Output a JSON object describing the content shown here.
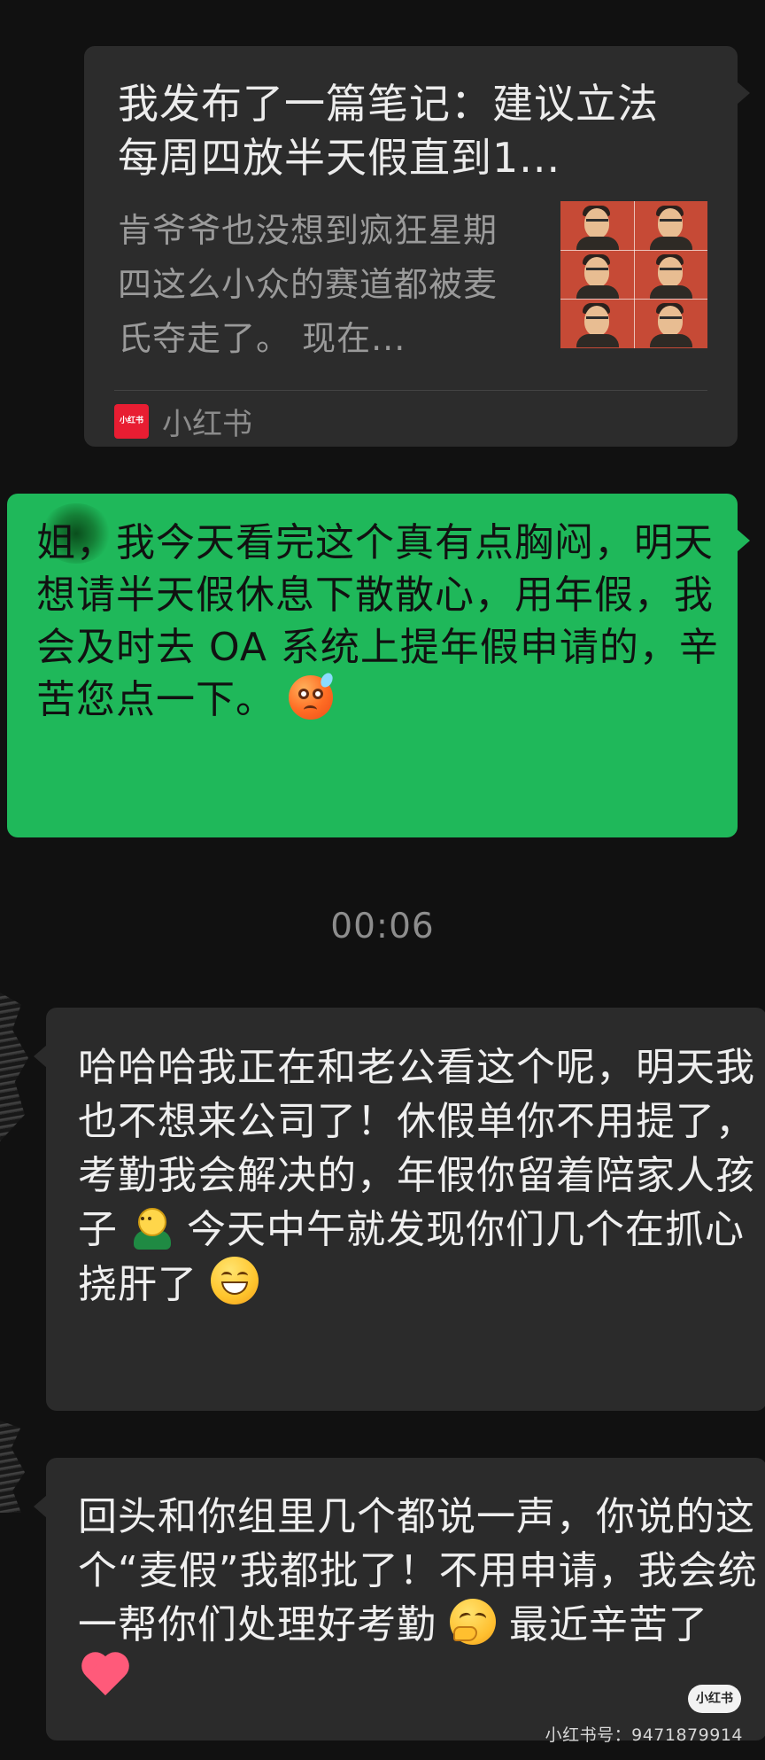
{
  "link_card": {
    "title": "我发布了一篇笔记：建议立法每周四放半天假直到1...",
    "summary": "肯爷爷也没想到疯狂星期四这么小众的赛道都被麦氏夺走了。 现在...",
    "source_logo_text": "小红书",
    "source_name": "小红书"
  },
  "sent_message": {
    "text": "姐，我今天看完这个真有点胸闷，明天想请半天假休息下散散心，用年假，我会及时去 OA 系统上提年假申请的，辛苦您点一下。"
  },
  "timestamp": "00:06",
  "received_messages": [
    {
      "part_1": "哈哈哈我正在和老公看这个呢，明天我也不想来公司了！休假单你不用提了，考勤我会解决的，年假你留着陪家人孩子",
      "part_2": "今天中午就发现你们几个在抓心挠肝了"
    },
    {
      "part_1": "回头和你组里几个都说一声，你说的这个“麦假”我都批了！不用申请，我会统一帮你们处理好考勤",
      "part_2": "最近辛苦了"
    }
  ],
  "watermark": {
    "badge": "小红书",
    "id_text": "小红书号：9471879914"
  },
  "colors": {
    "background": "#111111",
    "sent_bubble": "#1fb85a",
    "received_bubble": "#2b2b2b",
    "source_logo": "#e81d32"
  },
  "icons": [
    "sweat-face-icon",
    "boy-icon",
    "grinning-face-icon",
    "thinking-face-icon",
    "red-heart-icon",
    "xiaohongshu-logo-icon"
  ]
}
